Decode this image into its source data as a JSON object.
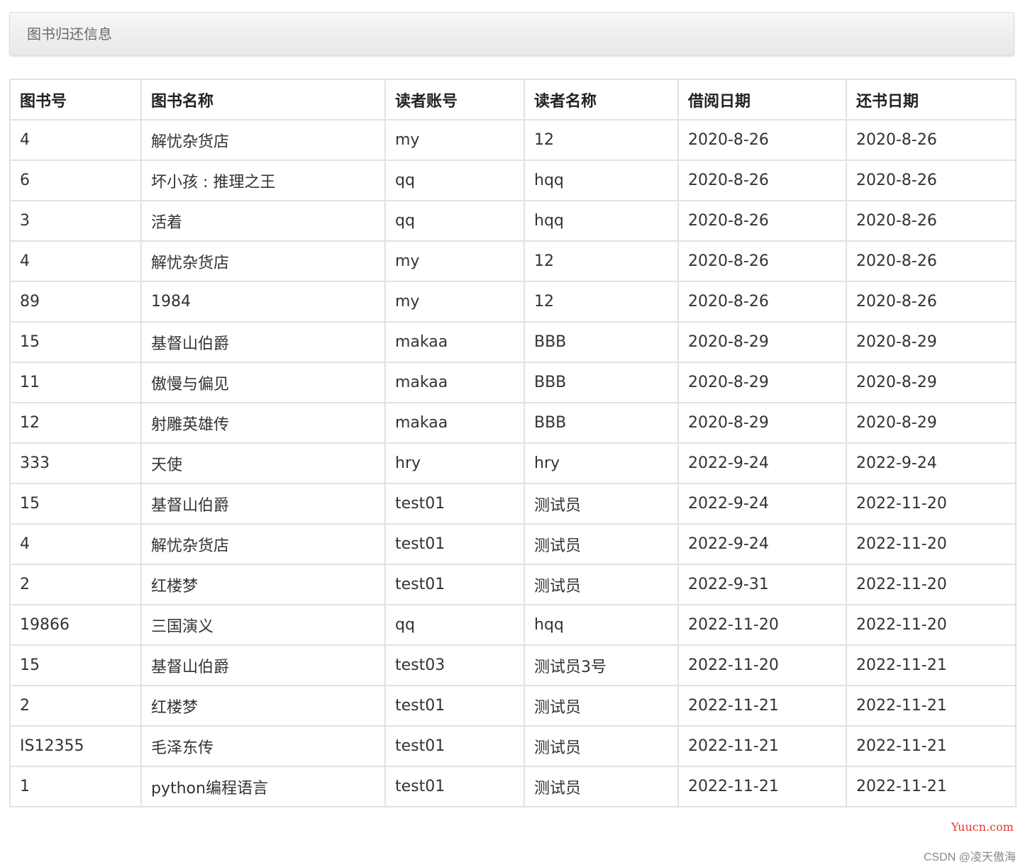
{
  "panel": {
    "title": "图书归还信息"
  },
  "table": {
    "columns": [
      "图书号",
      "图书名称",
      "读者账号",
      "读者名称",
      "借阅日期",
      "还书日期"
    ],
    "rows": [
      [
        "4",
        "解忧杂货店",
        "my",
        "12",
        "2020-8-26",
        "2020-8-26"
      ],
      [
        "6",
        "坏小孩 : 推理之王",
        "qq",
        "hqq",
        "2020-8-26",
        "2020-8-26"
      ],
      [
        "3",
        "活着",
        "qq",
        "hqq",
        "2020-8-26",
        "2020-8-26"
      ],
      [
        "4",
        "解忧杂货店",
        "my",
        "12",
        "2020-8-26",
        "2020-8-26"
      ],
      [
        "89",
        "1984",
        "my",
        "12",
        "2020-8-26",
        "2020-8-26"
      ],
      [
        "15",
        "基督山伯爵",
        "makaa",
        "BBB",
        "2020-8-29",
        "2020-8-29"
      ],
      [
        "11",
        "傲慢与偏见",
        "makaa",
        "BBB",
        "2020-8-29",
        "2020-8-29"
      ],
      [
        "12",
        "射雕英雄传",
        "makaa",
        "BBB",
        "2020-8-29",
        "2020-8-29"
      ],
      [
        "333",
        "天使",
        "hry",
        "hry",
        "2022-9-24",
        "2022-9-24"
      ],
      [
        "15",
        "基督山伯爵",
        "test01",
        "测试员",
        "2022-9-24",
        "2022-11-20"
      ],
      [
        "4",
        "解忧杂货店",
        "test01",
        "测试员",
        "2022-9-24",
        "2022-11-20"
      ],
      [
        "2",
        "红楼梦",
        "test01",
        "测试员",
        "2022-9-31",
        "2022-11-20"
      ],
      [
        "19866",
        "三国演义",
        "qq",
        "hqq",
        "2022-11-20",
        "2022-11-20"
      ],
      [
        "15",
        "基督山伯爵",
        "test03",
        "测试员3号",
        "2022-11-20",
        "2022-11-21"
      ],
      [
        "2",
        "红楼梦",
        "test01",
        "测试员",
        "2022-11-21",
        "2022-11-21"
      ],
      [
        "IS12355",
        "毛泽东传",
        "test01",
        "测试员",
        "2022-11-21",
        "2022-11-21"
      ],
      [
        "1",
        "python编程语言",
        "test01",
        "测试员",
        "2022-11-21",
        "2022-11-21"
      ]
    ]
  },
  "watermarks": {
    "site": "Yuucn.com",
    "author": "CSDN @凌天傲海"
  }
}
